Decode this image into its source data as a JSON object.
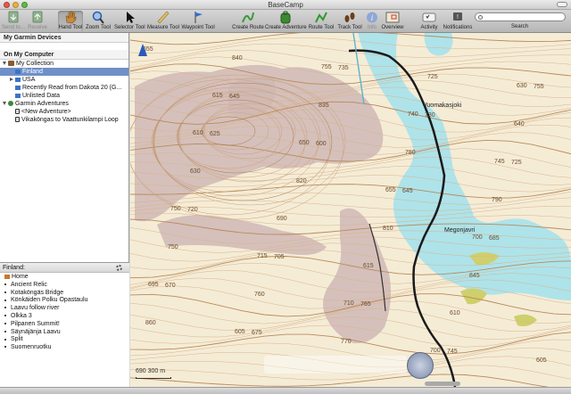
{
  "window": {
    "title": "BaseCamp"
  },
  "toolbar": {
    "send_gps": "Send to…",
    "receive": "Receive",
    "hand_tool": "Hand Tool",
    "zoom_tool": "Zoom Tool",
    "selector_tool": "Selector Tool",
    "measure_tool": "Measure Tool",
    "waypoint_tool": "Waypoint Tool",
    "create_route": "Create Route",
    "create_adventure": "Create Adventure",
    "route_tool": "Route Tool",
    "track_tool": "Track Tool",
    "info": "Info",
    "overview": "Overview",
    "activity": "Activity",
    "notifications": "Notifications",
    "search_label": "Search",
    "search_placeholder": "",
    "accent_color": "#6f8fc9"
  },
  "sidebar": {
    "devices_header": "My Garmin Devices",
    "computer_header": "On My Computer",
    "tree": [
      {
        "label": "My Collection",
        "level": 0,
        "icon": "folder-icon",
        "expand": "open"
      },
      {
        "label": "Finland",
        "level": 1,
        "icon": "flag-icon",
        "expand": "none",
        "selected": true
      },
      {
        "label": "USA",
        "level": 1,
        "icon": "flag-icon",
        "expand": "closed"
      },
      {
        "label": "Recently Read from Dakota 20 (G...",
        "level": 1,
        "icon": "flag-icon",
        "expand": "none"
      },
      {
        "label": "Unlisted Data",
        "level": 1,
        "icon": "flag-icon",
        "expand": "none"
      },
      {
        "label": "Garmin Adventures",
        "level": 0,
        "icon": "globe-icon",
        "expand": "open"
      },
      {
        "label": "<New Adventure>",
        "level": 1,
        "icon": "adventure-icon",
        "expand": "none"
      },
      {
        "label": "Vikaköngas to Vaattunkilampi Loop",
        "level": 1,
        "icon": "adventure-icon",
        "expand": "none"
      }
    ]
  },
  "list_panel": {
    "title": "Finland:",
    "items": [
      "Home",
      "Ancient Relic",
      "Kotaköngäs Bridge",
      "Könkäiden Polku Opastaulu",
      "Laavu follow river",
      "Olkka 3",
      "Pilpanen Summit!",
      "Säynäjänja Laavu",
      "Split",
      "Suomenruotku"
    ]
  },
  "map": {
    "scale_label": "690 300 m",
    "place_names": [
      "Vuomakasjoki",
      "Megonjavri"
    ],
    "contour_labels": [
      "655",
      "645",
      "600",
      "645",
      "685",
      "670",
      "675",
      "735",
      "730",
      "725",
      "720",
      "705",
      "765",
      "745",
      "755",
      "625",
      "820",
      "810",
      "845",
      "860",
      "840",
      "835",
      "780",
      "790",
      "750",
      "760",
      "770",
      "725",
      "640",
      "630",
      "690",
      "615",
      "610",
      "605",
      "615",
      "650",
      "655",
      "700",
      "695",
      "605",
      "755",
      "740",
      "745",
      "750",
      "715",
      "710",
      "700",
      "630",
      "610"
    ]
  }
}
